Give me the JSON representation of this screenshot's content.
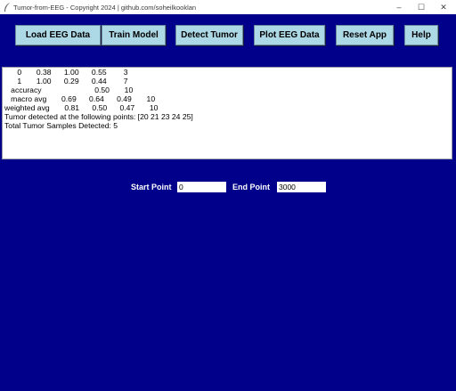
{
  "window": {
    "title": "Tumor-from-EEG - Copyright 2024 | github.com/soheilkooklan",
    "minimize_glyph": "–",
    "maximize_glyph": "☐",
    "close_glyph": "✕"
  },
  "toolbar": {
    "load_label": "Load EEG Data",
    "train_label": "Train Model",
    "detect_label": "Detect Tumor",
    "plot_label": "Plot EEG Data",
    "reset_label": "Reset App",
    "help_label": "Help"
  },
  "output": {
    "report_lines": [
      "      0       0.38      1.00      0.55        3",
      "      1       1.00      0.29      0.44        7",
      "",
      "   accuracy                         0.50       10",
      "   macro avg       0.69      0.64      0.49       10",
      "weighted avg       0.81      0.50      0.47       10",
      "",
      "Tumor detected at the following points: [20 21 23 24 25]",
      "Total Tumor Samples Detected: 5"
    ]
  },
  "range": {
    "start_label": "Start Point",
    "start_value": "0",
    "end_label": "End Point",
    "end_value": "3000"
  },
  "colors": {
    "background": "#00008b",
    "button": "#add8e6"
  }
}
